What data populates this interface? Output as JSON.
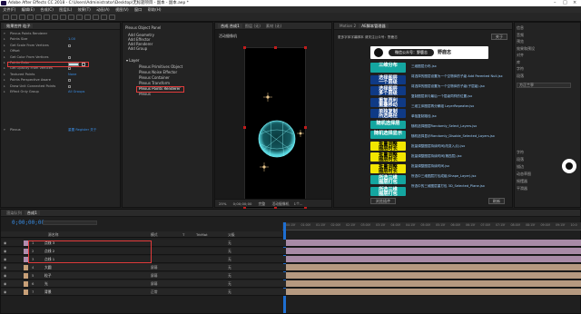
{
  "window": {
    "title": "Adobe After Effects CC 2018 - C:\\Users\\Administrator\\Desktop\\无标题项目 - 副本 - 副本.aep *"
  },
  "menu": [
    "文件(F)",
    "编辑(E)",
    "合成(C)",
    "图层(L)",
    "效果(T)",
    "动画(A)",
    "视图(V)",
    "窗口",
    "帮助(H)"
  ],
  "effect_controls": {
    "tab": "效果控件 粒子",
    "rows": [
      {
        "label": "Plexus Points Renderer",
        "val": ""
      },
      {
        "label": "Points Size",
        "val": "1.00"
      },
      {
        "label": "Get Scale From Vertices",
        "val": ""
      },
      {
        "label": "Offset",
        "val": ""
      },
      {
        "label": "Get Color From Vertices",
        "val": ""
      },
      {
        "label": "Points Color",
        "val": ""
      },
      {
        "label": "Get Opacity From Vertices",
        "val": ""
      },
      {
        "label": "Textured Points",
        "val": "None"
      },
      {
        "label": "Points Perspective Aware",
        "val": ""
      },
      {
        "label": "Draw Unit Connected Points",
        "val": ""
      },
      {
        "label": "Effect Only Group",
        "val": "All Groups"
      },
      {
        "label": "Plexus",
        "val": "重置   Register   关于"
      }
    ]
  },
  "plexus": {
    "tab": "Plexus Object Panel",
    "add_items": [
      "Add Geometry",
      "Add Effector",
      "Add Renderer",
      "Add Group"
    ],
    "layer_label": "Layer",
    "tree": [
      "Plexus Primitives Object",
      "Plexus Noise Effector",
      "Plexus Container",
      "Plexus Transform",
      "Plexus Points Renderer",
      "Plexus"
    ]
  },
  "composition": {
    "tabs": [
      "合成 合成1",
      "图层 (无)",
      "素材 (无)"
    ],
    "label": "活动摄像机",
    "zoom": "25%",
    "time": "0;00;00;00",
    "quality": "完整",
    "camera": "活动摄像机",
    "views": "1个..."
  },
  "script_panel": {
    "tabs": [
      "Motion 2",
      "AE脚本管理器"
    ],
    "header": "更多字体字幕脚本 请关注公众号：野鹿志",
    "wechat": "微信公众号：野鹿志",
    "badge": "野鹿志",
    "btn_top": "关于",
    "categories": [
      {
        "label": "三维分布",
        "bg": "#14a6a0",
        "fg": "#ffffff",
        "h": 11
      },
      {
        "label": "选择图层\n一个层级",
        "bg": "#0f3a86",
        "fg": "#ffffff",
        "h": 10
      },
      {
        "label": "选择图层\n多个层级",
        "bg": "#0f3a86",
        "fg": "#ffffff",
        "h": 10
      },
      {
        "label": "重复再利\n重叠移动",
        "bg": "#0f3a86",
        "fg": "#ffffff",
        "h": 10
      },
      {
        "label": "单独复制\n所选路径",
        "bg": "#0f3a86",
        "fg": "#ffffff",
        "h": 10
      },
      {
        "label": "随机选择层",
        "bg": "#14a6a0",
        "fg": "#ffffff",
        "h": 9
      },
      {
        "label": "随机选择显示",
        "bg": "#14a6a0",
        "fg": "#ffffff",
        "h": 9
      },
      {
        "label": "批量调整\n图层时长",
        "bg": "#f2e600",
        "fg": "#000000",
        "h": 10
      },
      {
        "label": "批量调整\n图层时长",
        "bg": "#f2e600",
        "fg": "#000000",
        "h": 10
      },
      {
        "label": "批量调整\n图层时长",
        "bg": "#f2e600",
        "fg": "#000000",
        "h": 10
      },
      {
        "label": "所选三维\n图层打包",
        "bg": "#14a6a0",
        "fg": "#ffffff",
        "h": 10
      },
      {
        "label": "所选三维\n图层打包",
        "bg": "#14a6a0",
        "fg": "#ffffff",
        "h": 10
      }
    ],
    "items": [
      "三维图层分布.jsx",
      "将选择的图层设置为一个空物体的子级 Add Parented Null.jsx",
      "将选择的图层设置为一个空物体的子级(子层级).jsx",
      "复制图层到与最后一个层级同样的位置.jsx",
      "三维立体图层再分解组 LayerRepeater.jsx",
      "单独复制路径.jsx",
      "随机选择图层Randomly_Select_Layers.jsx",
      "随机选择显示Randomly_Disable_Selected_Layers.jsx",
      "批量调整图层持续时间(改变入点).jsx",
      "批量调整图层持续时间(第四层).jsx",
      "批量调整图层持续时间.jsx",
      "所选中三维图层打包成组(Shape_Layer).jsx",
      "所选中的三维图层重打包 3D_Selected_Plane.jsx"
    ],
    "btn_browse": "浏览插件",
    "btn_refresh": "刷新"
  },
  "right_panel": {
    "items": [
      "信息",
      "音频",
      "预览",
      "效果和预设",
      "对齐",
      "库",
      "字符",
      "段落"
    ],
    "font": "方正兰亭",
    "char_rows": [
      "字符",
      "段落",
      "描边",
      "动态草图",
      "摇摆器",
      "平滑器"
    ]
  },
  "timeline": {
    "tabs": [
      "渲染队列",
      "合成1"
    ],
    "timecode": "0;00;00;00",
    "headers": [
      "源名称",
      "模式",
      "T",
      "TrkMat",
      "父级"
    ],
    "layers": [
      {
        "num": "1",
        "name": "点线 3",
        "mode": "",
        "parent": "无",
        "color": "#b08cae"
      },
      {
        "num": "2",
        "name": "点线 2",
        "mode": "",
        "parent": "无",
        "color": "#b08cae"
      },
      {
        "num": "3",
        "name": "点线 1",
        "mode": "",
        "parent": "无",
        "color": "#b08cae"
      },
      {
        "num": "4",
        "name": "大圆",
        "mode": "屏幕",
        "parent": "无",
        "color": "#c8a078"
      },
      {
        "num": "5",
        "name": "粒子",
        "mode": "屏幕",
        "parent": "无",
        "color": "#c8a078"
      },
      {
        "num": "6",
        "name": "光",
        "mode": "屏幕",
        "parent": "无",
        "color": "#c8a078"
      },
      {
        "num": "7",
        "name": "背景",
        "mode": "正常",
        "parent": "无",
        "color": "#c8a078"
      }
    ],
    "ticks": [
      "00:15f",
      "01:00f",
      "01:15f",
      "02:00f",
      "02:15f",
      "03:00f",
      "03:15f",
      "04:00f",
      "04:15f",
      "05:00f",
      "05:15f",
      "06:00f",
      "06:15f",
      "07:00f",
      "07:15f",
      "08:00f",
      "08:15f",
      "09:00f",
      "09:15f",
      "10:0"
    ]
  }
}
